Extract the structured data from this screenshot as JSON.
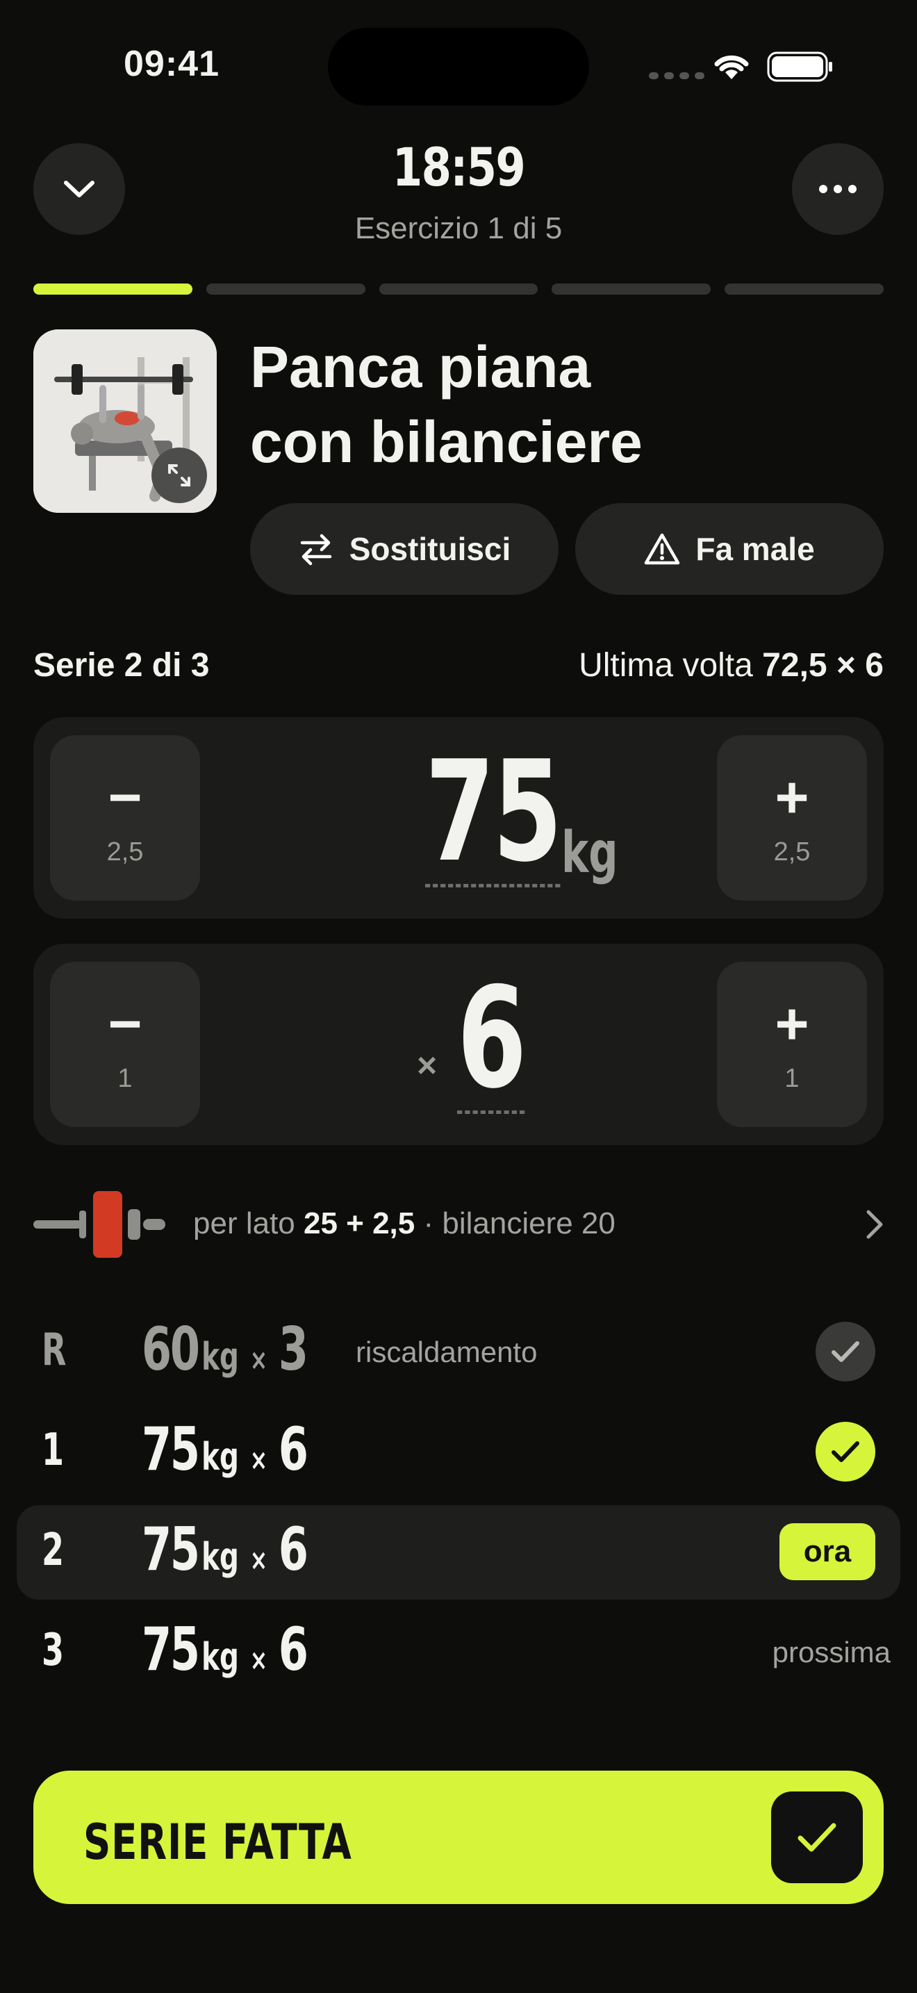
{
  "status_bar": {
    "time": "09:41"
  },
  "header": {
    "timer": "18:59",
    "subtitle": "Esercizio 1 di 5",
    "progress_total": 5,
    "progress_current": 1
  },
  "exercise": {
    "title_line1": "Panca piana",
    "title_line2": "con bilanciere",
    "substitute_label": "Sostituisci",
    "hurts_label": "Fa male"
  },
  "set_info": {
    "label": "Serie 2 di 3",
    "last_time_prefix": "Ultima volta",
    "last_time_value": "72,5 × 6"
  },
  "weight_stepper": {
    "value": "75",
    "unit": "kg",
    "minus_symbol": "−",
    "plus_symbol": "+",
    "increment": "2,5"
  },
  "reps_stepper": {
    "value": "6",
    "times_symbol": "×",
    "minus_symbol": "−",
    "plus_symbol": "+",
    "increment": "1"
  },
  "plates": {
    "prefix": "per lato",
    "per_side": "25 + 2,5",
    "suffix": "· bilanciere 20",
    "plate_color": "#d33a24"
  },
  "sets": [
    {
      "index": "R",
      "weight": "60",
      "unit": "kg",
      "x": "×",
      "reps": "3",
      "note": "riscaldamento",
      "status": "done-warmup"
    },
    {
      "index": "1",
      "weight": "75",
      "unit": "kg",
      "x": "×",
      "reps": "6",
      "note": "",
      "status": "done"
    },
    {
      "index": "2",
      "weight": "75",
      "unit": "kg",
      "x": "×",
      "reps": "6",
      "note": "",
      "status": "ora"
    },
    {
      "index": "3",
      "weight": "75",
      "unit": "kg",
      "x": "×",
      "reps": "6",
      "note": "",
      "status": "prossima"
    }
  ],
  "cta": {
    "label": "SERIE FATTA"
  },
  "colors": {
    "accent": "#d6f43a",
    "background": "#0d0d0c",
    "card": "#1b1b1a"
  }
}
